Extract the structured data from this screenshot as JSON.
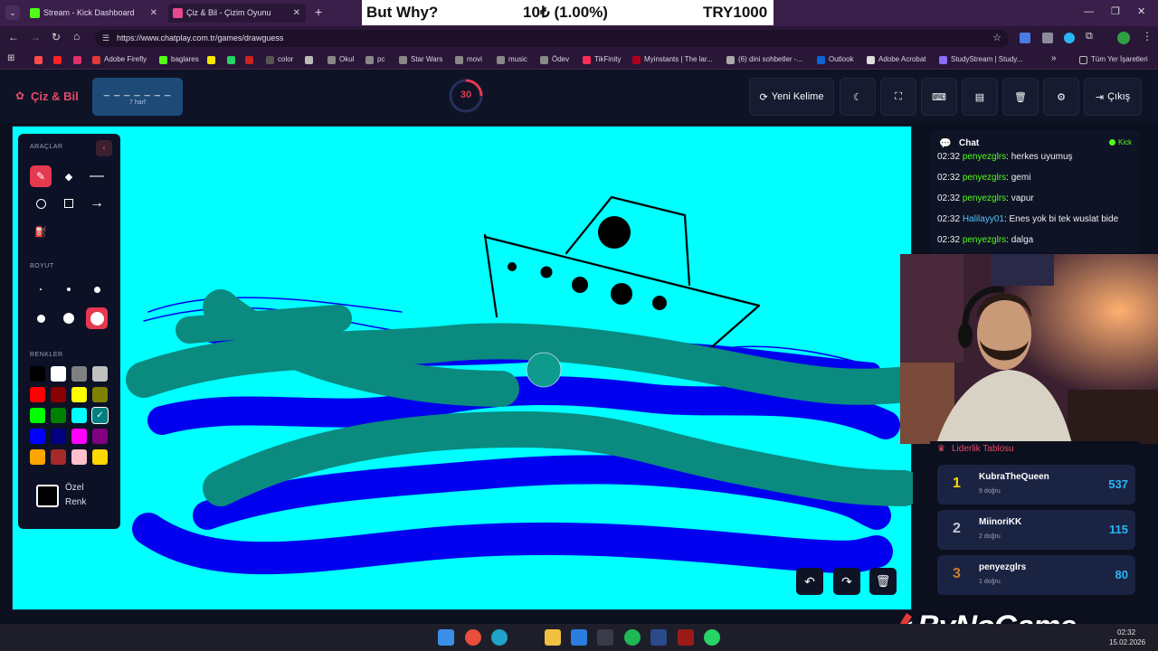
{
  "browser": {
    "tabs": [
      {
        "title": "Stream - Kick Dashboard",
        "favicon_color": "#53fc18",
        "active": false
      },
      {
        "title": "Çiz & Bil - Çizim Oyunu",
        "favicon_color": "#e64a8a",
        "active": true
      }
    ],
    "new_tab": "+",
    "url": "https://www.chatplay.com.tr/games/drawguess",
    "bookmarks": [
      {
        "label": "",
        "color": "#ff4d4d"
      },
      {
        "label": "",
        "color": "#ff2020"
      },
      {
        "label": "",
        "color": "#e1306c"
      },
      {
        "label": "Adobe Firefly",
        "color": "#e03a3a"
      },
      {
        "label": "baglares",
        "color": "#53fc18"
      },
      {
        "label": "",
        "color": "#f7e600"
      },
      {
        "label": "",
        "color": "#25d366"
      },
      {
        "label": "",
        "color": "#cc2222"
      },
      {
        "label": "color",
        "color": "#555"
      },
      {
        "label": "",
        "color": "#bbb"
      },
      {
        "label": "Okul",
        "color": "#888"
      },
      {
        "label": "pc",
        "color": "#888"
      },
      {
        "label": "Star Wars",
        "color": "#888"
      },
      {
        "label": "movi",
        "color": "#888"
      },
      {
        "label": "music",
        "color": "#888"
      },
      {
        "label": "Ödev",
        "color": "#888"
      },
      {
        "label": "TikFinity",
        "color": "#ff2d55"
      },
      {
        "label": "Myinstants | The lar...",
        "color": "#b00020"
      },
      {
        "label": "(6) dini sohbetler -...",
        "color": "#aaa"
      },
      {
        "label": "Outlook",
        "color": "#0a64d8"
      },
      {
        "label": "Adobe Acrobat",
        "color": "#ddd"
      },
      {
        "label": "StudyStream | Study...",
        "color": "#8a6cff"
      }
    ],
    "bookmarks_more": "»",
    "all_bookmarks": "Tüm Yer İşaretleri"
  },
  "overlay": {
    "left": "But Why?",
    "center": "10₺ (1.00%)",
    "right": "TRY1000"
  },
  "app": {
    "logo": "Çiz & Bil",
    "word_hint": "_ _ _ _ _ _ _",
    "letter_count": "7 harf",
    "timer": "30",
    "timer_progress": 0.25,
    "new_word": "Yeni Kelime",
    "exit": "Çıkış"
  },
  "tools": {
    "title": "ARAÇLAR",
    "size_title": "BOYUT",
    "colors_title": "RENKLER",
    "colors": [
      "#000000",
      "#ffffff",
      "#808080",
      "#c0c0c0",
      "#ff0000",
      "#8b0000",
      "#ffff00",
      "#808000",
      "#00ff00",
      "#008000",
      "#00ffff",
      "#008080",
      "#0000ff",
      "#000080",
      "#ff00ff",
      "#800080",
      "#ffa500",
      "#a52a2a",
      "#ffc0cb",
      "#ffd700"
    ],
    "selected_color": "#008080",
    "custom_line1": "Özel",
    "custom_line2": "Renk"
  },
  "chat": {
    "title": "Chat",
    "platform": "Kick",
    "messages": [
      {
        "time": "02:32",
        "user": "penyezglrs",
        "user_color": "#53fc18",
        "text": "herkes uyumuş"
      },
      {
        "time": "02:32",
        "user": "penyezglrs",
        "user_color": "#53fc18",
        "text": "gemi"
      },
      {
        "time": "02:32",
        "user": "penyezglrs",
        "user_color": "#53fc18",
        "text": "vapur"
      },
      {
        "time": "02:32",
        "user": "Halilayy01",
        "user_color": "#4fc3f7",
        "text": "Enes yok bi tek wuslat bide"
      },
      {
        "time": "02:32",
        "user": "penyezglrs",
        "user_color": "#53fc18",
        "text": "dalga"
      }
    ]
  },
  "leaderboard": {
    "title": "Liderlik Tablosu",
    "rows": [
      {
        "rank": "1",
        "name": "KubraTheQueen",
        "sub": "9 doğru",
        "score": "537",
        "rank_color": "#ffd700"
      },
      {
        "rank": "2",
        "name": "MiinoriKK",
        "sub": "2 doğru",
        "score": "115",
        "rank_color": "#c0c8d8"
      },
      {
        "rank": "3",
        "name": "penyezglrs",
        "sub": "1 doğru",
        "score": "80",
        "rank_color": "#cd7f32"
      }
    ]
  },
  "watermark": "ByNoGame",
  "taskbar": {
    "time": "02:32",
    "date": "15.02.2026"
  }
}
